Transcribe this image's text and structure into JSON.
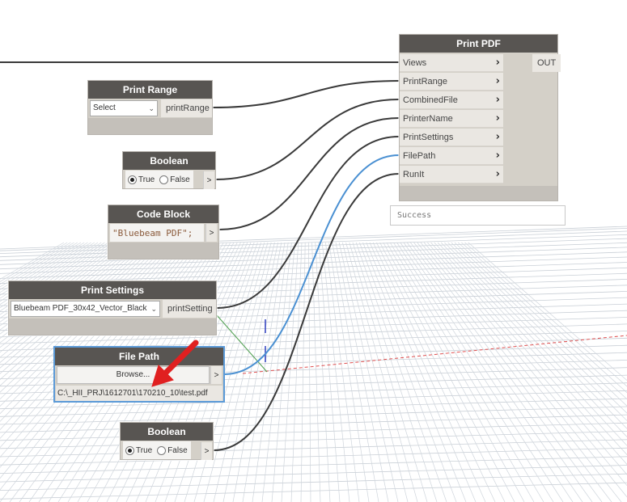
{
  "print_pdf_node": {
    "title": "Print PDF",
    "inputs": [
      "Views",
      "PrintRange",
      "CombinedFile",
      "PrinterName",
      "PrintSettings",
      "FilePath",
      "RunIt"
    ],
    "output": "OUT",
    "status": "Success"
  },
  "print_range_node": {
    "title": "Print Range",
    "dropdown_value": "Select",
    "output": "printRange"
  },
  "boolean_node_1": {
    "title": "Boolean",
    "true_label": "True",
    "false_label": "False",
    "out_label": ">"
  },
  "code_block_node": {
    "title": "Code Block",
    "code": "\"Bluebeam PDF\";",
    "out_label": ">"
  },
  "print_settings_node": {
    "title": "Print Settings",
    "dropdown_value": "Bluebeam PDF_30x42_Vector_Black",
    "output": "printSetting"
  },
  "file_path_node": {
    "title": "File Path",
    "browse_label": "Browse...",
    "path_value": "C:\\_HII_PRJ\\1612701\\170210_10\\test.pdf",
    "out_label": ">"
  },
  "boolean_node_2": {
    "title": "Boolean",
    "true_label": "True",
    "false_label": "False",
    "out_label": ">"
  },
  "colors": {
    "node_header": "#585552",
    "node_body": "#d4d0c8",
    "wire": "#3a3a3a",
    "wire_selected": "#4a90d2",
    "annotation_arrow": "#e02020"
  }
}
